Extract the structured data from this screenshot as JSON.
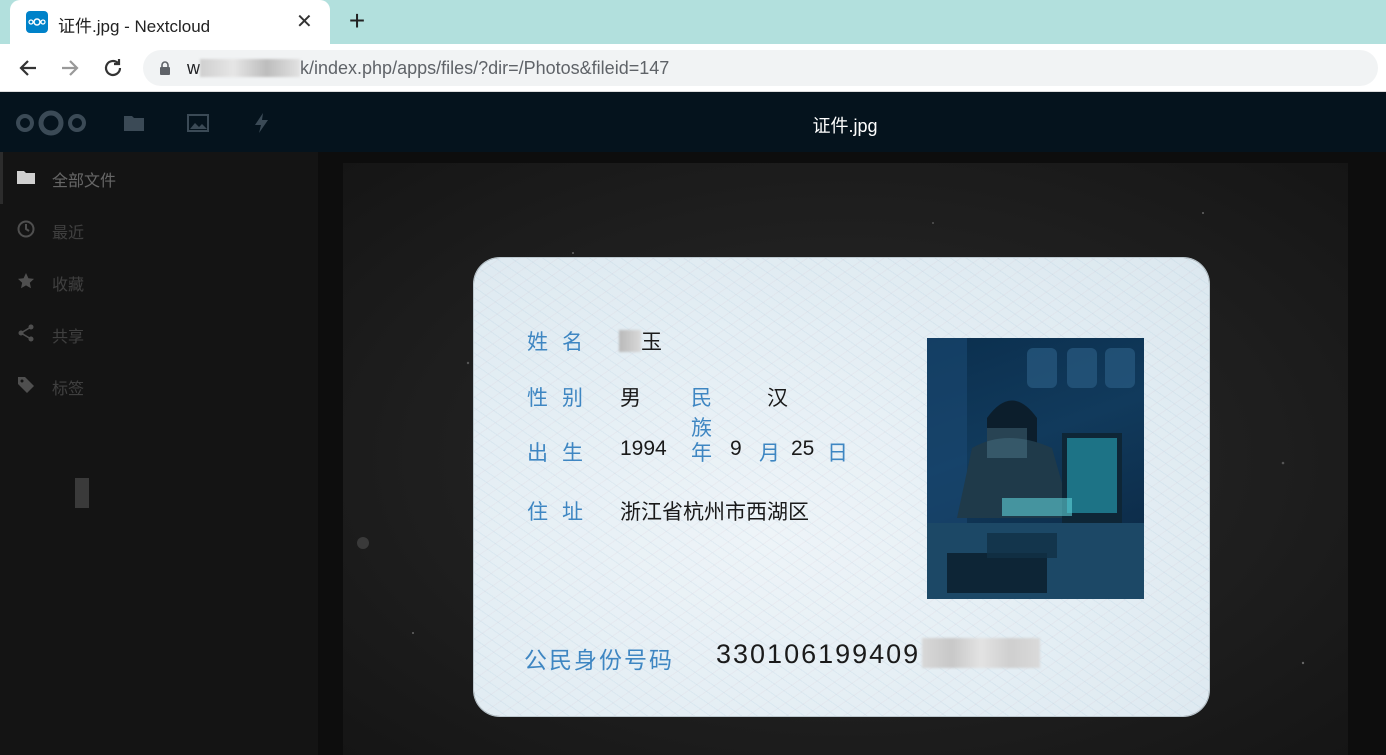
{
  "browser": {
    "tab_title": "证件.jpg - Nextcloud",
    "tab_close": "✕",
    "new_tab": "+",
    "url_host_prefix": "w",
    "url_host_suffix": "k",
    "url_path": "/index.php/apps/files/?dir=/Photos&fileid=147"
  },
  "nc": {
    "file_title": "证件.jpg",
    "sidebar": {
      "items": [
        {
          "label": "全部文件",
          "icon": "folder-icon"
        },
        {
          "label": "最近",
          "icon": "clock-icon"
        },
        {
          "label": "收藏",
          "icon": "star-icon"
        },
        {
          "label": "共享",
          "icon": "share-icon"
        },
        {
          "label": "标签",
          "icon": "tag-icon"
        }
      ]
    }
  },
  "idcard": {
    "name_label": "姓名",
    "name_value": "玉",
    "gender_label": "性别",
    "gender_value": "男",
    "ethnicity_label": "民族",
    "ethnicity_value": "汉",
    "birth_label": "出生",
    "birth_year": "1994",
    "year_char": "年",
    "birth_month": "9",
    "month_char": "月",
    "birth_day": "25",
    "day_char": "日",
    "address_label": "住址",
    "address_value": "浙江省杭州市西湖区",
    "id_label": "公民身份号码",
    "id_value_visible": "330106199409"
  }
}
